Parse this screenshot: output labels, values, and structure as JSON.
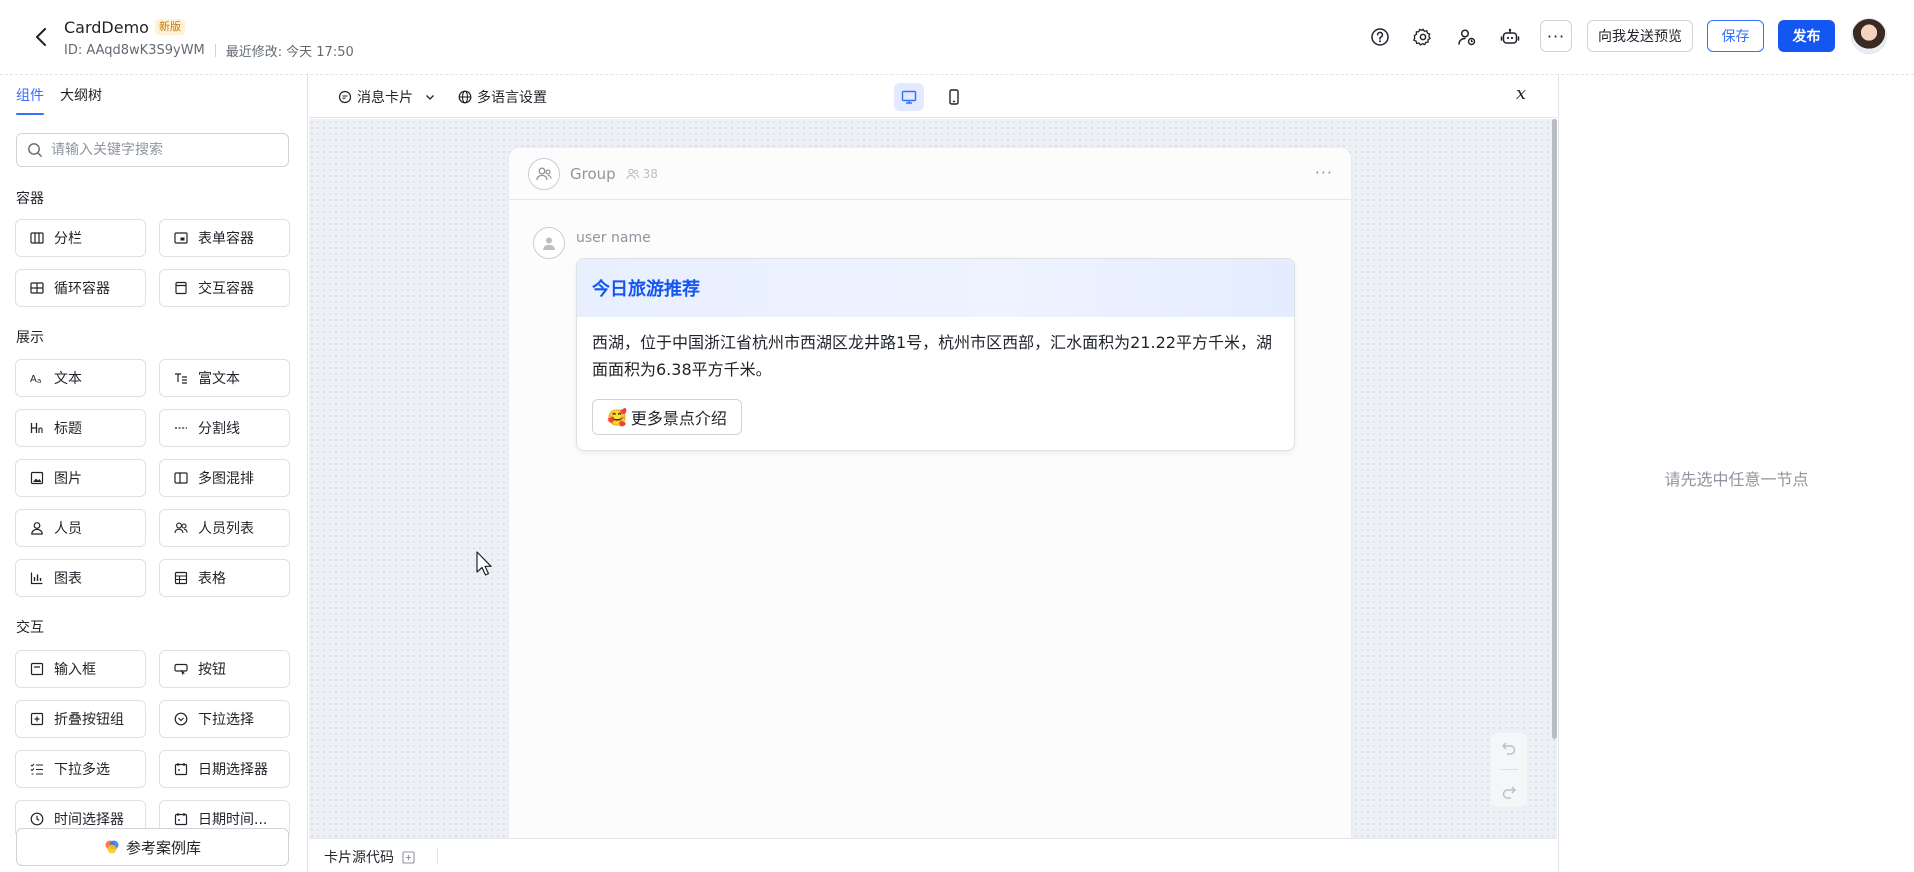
{
  "header": {
    "title": "CardDemo",
    "badge": "新版",
    "id_text": "ID: AAqd8wK3S9yWM",
    "modified_label": "最近修改:",
    "modified_value": "今天 17:50",
    "preview_label": "向我发送预览",
    "save_label": "保存",
    "publish_label": "发布",
    "more_label": "···"
  },
  "left_panel": {
    "tabs": [
      {
        "label": "组件"
      },
      {
        "label": "大纲树"
      }
    ],
    "search_placeholder": "请输入关键字搜索",
    "sections": [
      {
        "title": "容器",
        "items": [
          {
            "label": "分栏",
            "icon": "columns-icon"
          },
          {
            "label": "表单容器",
            "icon": "form-container-icon"
          },
          {
            "label": "循环容器",
            "icon": "loop-container-icon"
          },
          {
            "label": "交互容器",
            "icon": "interactive-container-icon"
          }
        ]
      },
      {
        "title": "展示",
        "items": [
          {
            "label": "文本",
            "icon": "text-icon"
          },
          {
            "label": "富文本",
            "icon": "rich-text-icon"
          },
          {
            "label": "标题",
            "icon": "heading-icon"
          },
          {
            "label": "分割线",
            "icon": "divider-icon"
          },
          {
            "label": "图片",
            "icon": "image-icon"
          },
          {
            "label": "多图混排",
            "icon": "multi-image-icon"
          },
          {
            "label": "人员",
            "icon": "person-icon"
          },
          {
            "label": "人员列表",
            "icon": "people-list-icon"
          },
          {
            "label": "图表",
            "icon": "chart-icon"
          },
          {
            "label": "表格",
            "icon": "table-icon"
          }
        ]
      },
      {
        "title": "交互",
        "items": [
          {
            "label": "输入框",
            "icon": "input-icon"
          },
          {
            "label": "按钮",
            "icon": "button-icon"
          },
          {
            "label": "折叠按钮组",
            "icon": "collapse-button-group-icon"
          },
          {
            "label": "下拉选择",
            "icon": "dropdown-icon"
          },
          {
            "label": "下拉多选",
            "icon": "multi-select-icon"
          },
          {
            "label": "日期选择器",
            "icon": "date-picker-icon"
          },
          {
            "label": "时间选择器",
            "icon": "time-picker-icon"
          },
          {
            "label": "日期时间...",
            "icon": "datetime-picker-icon"
          }
        ]
      }
    ],
    "reference_label": "参考案例库"
  },
  "toolbar": {
    "card_type_label": "消息卡片",
    "i18n_label": "多语言设置",
    "variable_label": "𝑥"
  },
  "canvas": {
    "group_name": "Group",
    "group_count": "38",
    "user_name": "user name",
    "card": {
      "title": "今日旅游推荐",
      "body": "西湖，位于中国浙江省杭州市西湖区龙井路1号，杭州市区西部，汇水面积为21.22平方千米，湖面面积为6.38平方千米。",
      "button_emoji": "🥰",
      "button_label": "更多景点介绍"
    }
  },
  "bottom_bar": {
    "source_code_label": "卡片源代码"
  },
  "right_panel": {
    "empty_hint": "请先选中任意一节点"
  },
  "colors": {
    "primary": "#1456f0",
    "accent_blue": "#3370ff",
    "card_header_bg": "#e8efff"
  }
}
